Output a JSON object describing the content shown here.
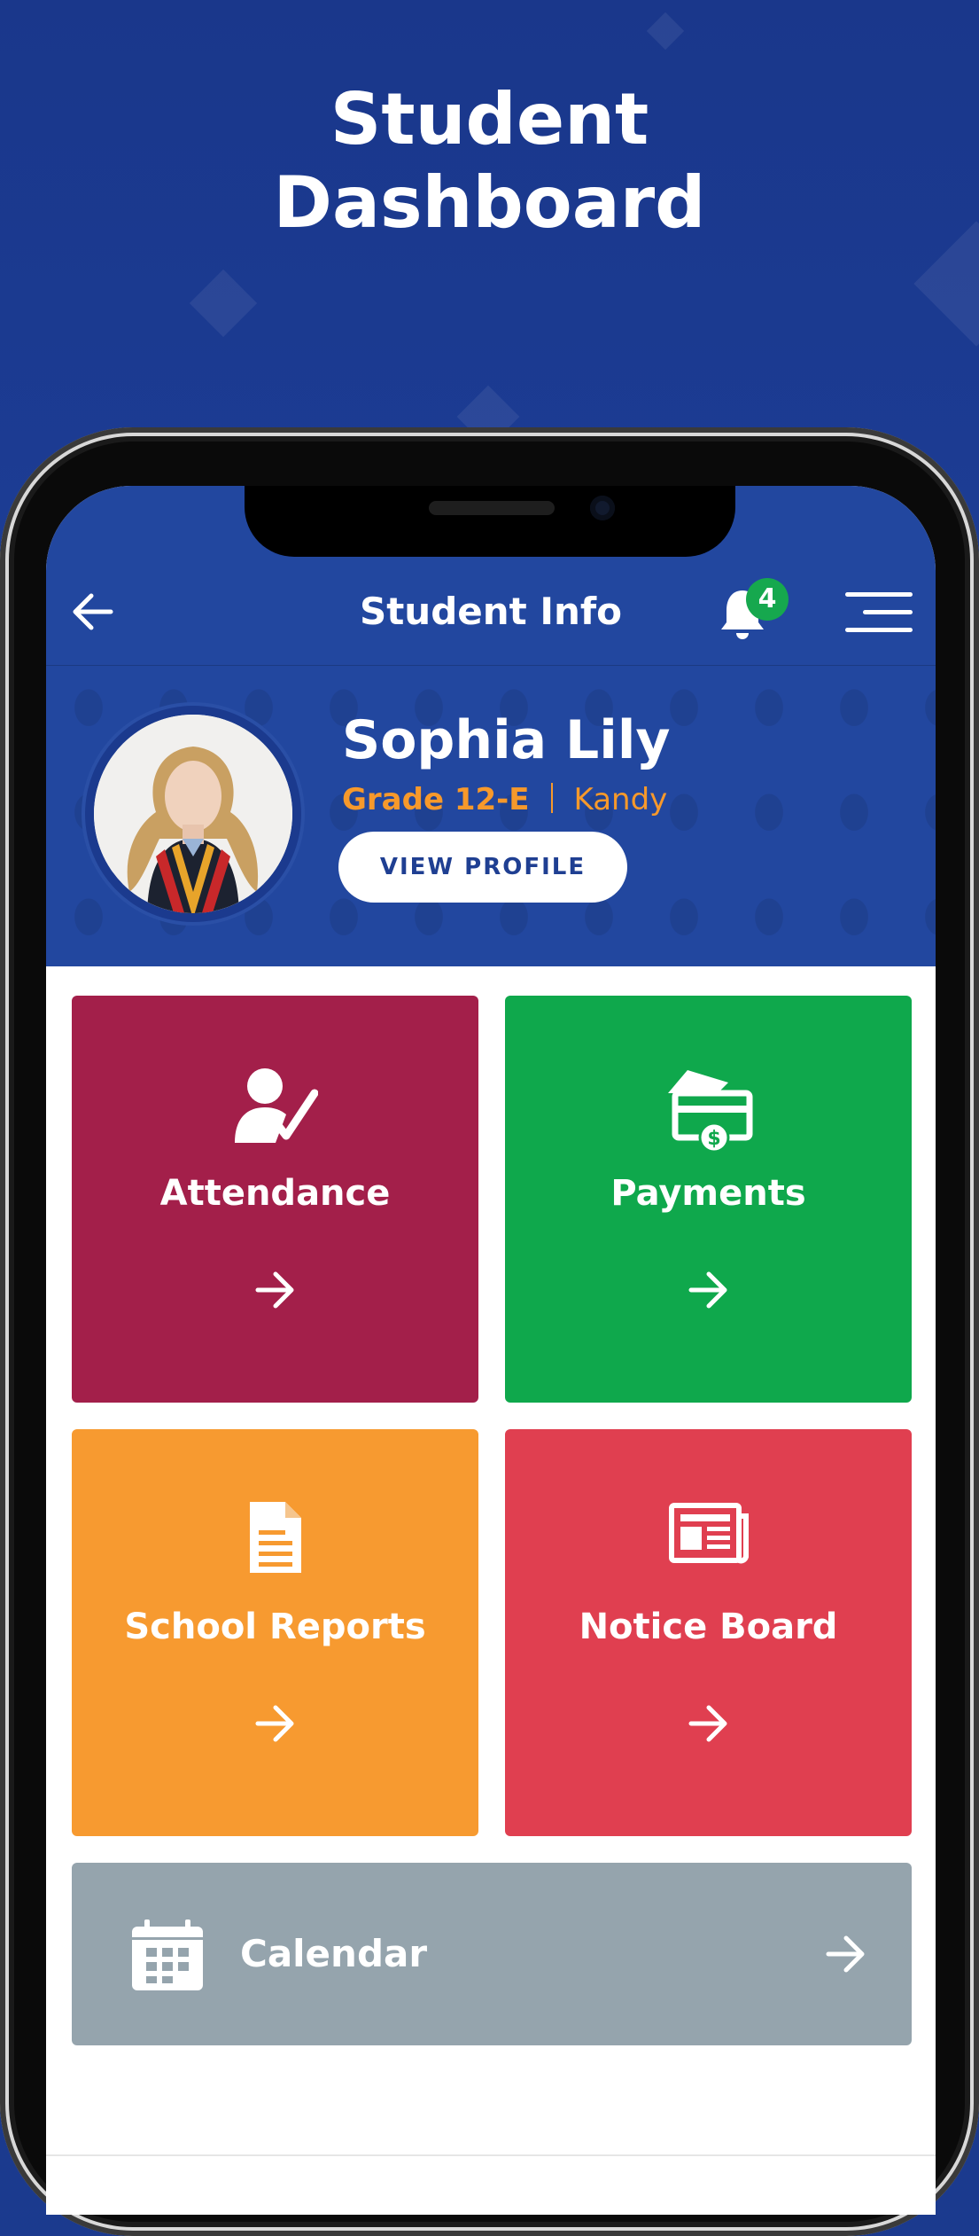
{
  "promo": {
    "title_line1": "Student",
    "title_line2": "Dashboard"
  },
  "topbar": {
    "title": "Student Info",
    "notification_count": "4",
    "back_icon": "arrow-left-icon",
    "bell_icon": "bell-icon",
    "menu_icon": "menu-icon"
  },
  "profile": {
    "name": "Sophia Lily",
    "grade": "Grade 12-E",
    "location": "Kandy",
    "view_profile_label": "VIEW PROFILE"
  },
  "tiles": [
    {
      "label": "Attendance",
      "icon": "user-check-icon",
      "color": "#a31f4a"
    },
    {
      "label": "Payments",
      "icon": "payment-card-icon",
      "color": "#0fa84c"
    },
    {
      "label": "School Reports",
      "icon": "document-icon",
      "color": "#f79a30"
    },
    {
      "label": "Notice Board",
      "icon": "newspaper-icon",
      "color": "#e03f50"
    }
  ],
  "calendar": {
    "label": "Calendar",
    "icon": "calendar-icon",
    "color": "#95a4ad"
  },
  "colors": {
    "primary": "#22479f",
    "accent": "#f7992b",
    "badge": "#16a84e"
  }
}
